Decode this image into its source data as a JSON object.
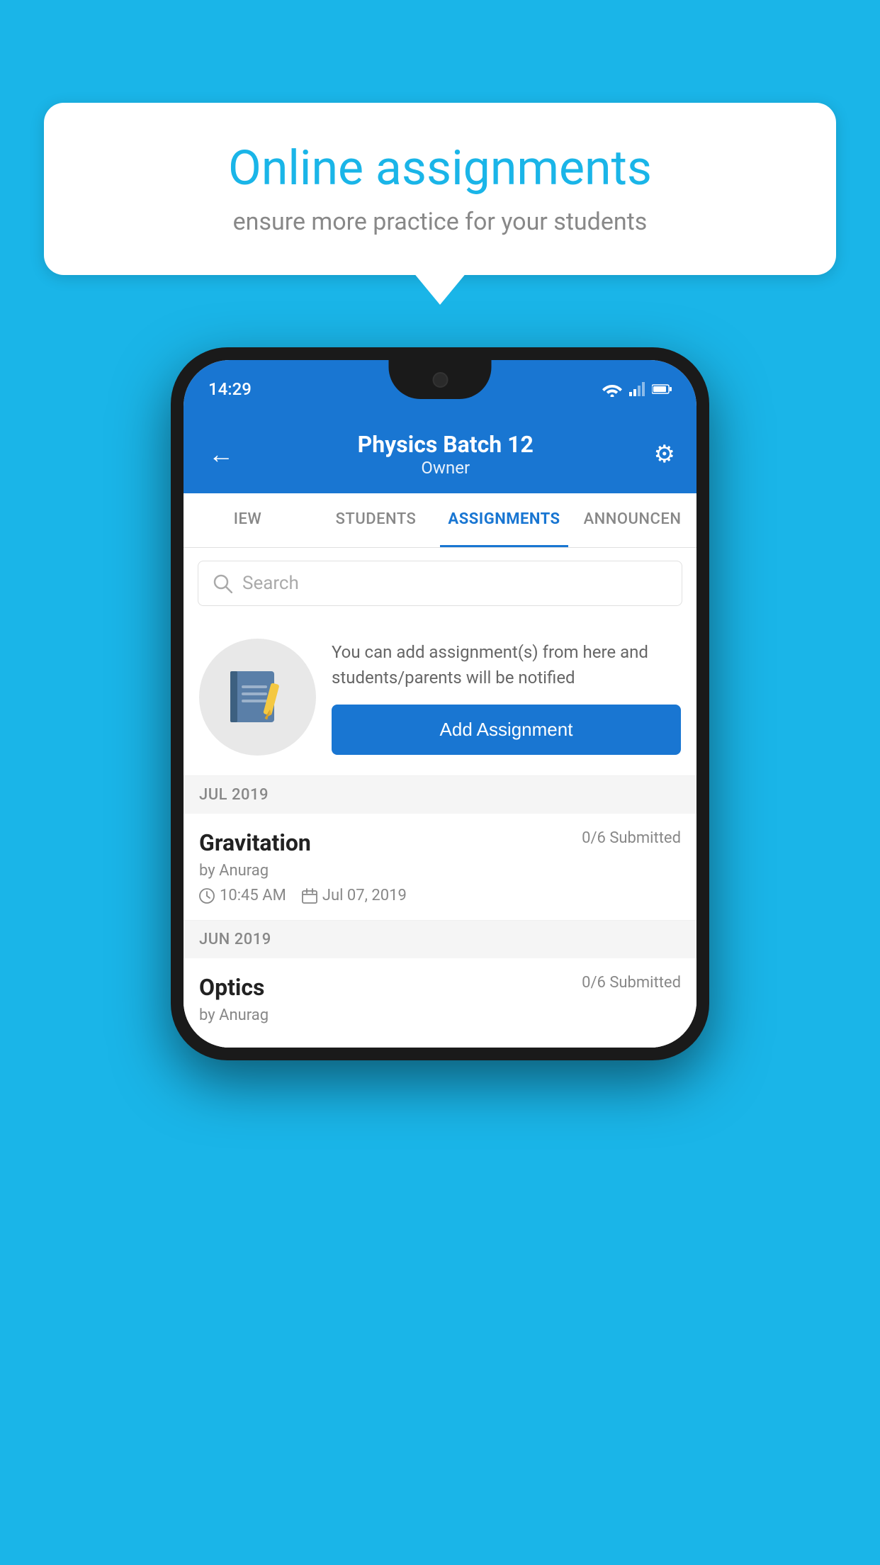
{
  "background_color": "#1ab5e8",
  "speech_bubble": {
    "title": "Online assignments",
    "subtitle": "ensure more practice for your students"
  },
  "phone": {
    "status_bar": {
      "time": "14:29"
    },
    "header": {
      "title": "Physics Batch 12",
      "subtitle": "Owner",
      "back_label": "←",
      "settings_label": "⚙"
    },
    "tabs": [
      {
        "label": "IEW",
        "active": false
      },
      {
        "label": "STUDENTS",
        "active": false
      },
      {
        "label": "ASSIGNMENTS",
        "active": true
      },
      {
        "label": "ANNOUNCEN",
        "active": false
      }
    ],
    "search": {
      "placeholder": "Search"
    },
    "add_assignment_section": {
      "description": "You can add assignment(s) from here and students/parents will be notified",
      "button_label": "Add Assignment"
    },
    "sections": [
      {
        "month_label": "JUL 2019",
        "assignments": [
          {
            "name": "Gravitation",
            "submitted": "0/6 Submitted",
            "by": "by Anurag",
            "time": "10:45 AM",
            "date": "Jul 07, 2019"
          }
        ]
      },
      {
        "month_label": "JUN 2019",
        "assignments": [
          {
            "name": "Optics",
            "submitted": "0/6 Submitted",
            "by": "by Anurag",
            "time": "",
            "date": ""
          }
        ]
      }
    ]
  }
}
